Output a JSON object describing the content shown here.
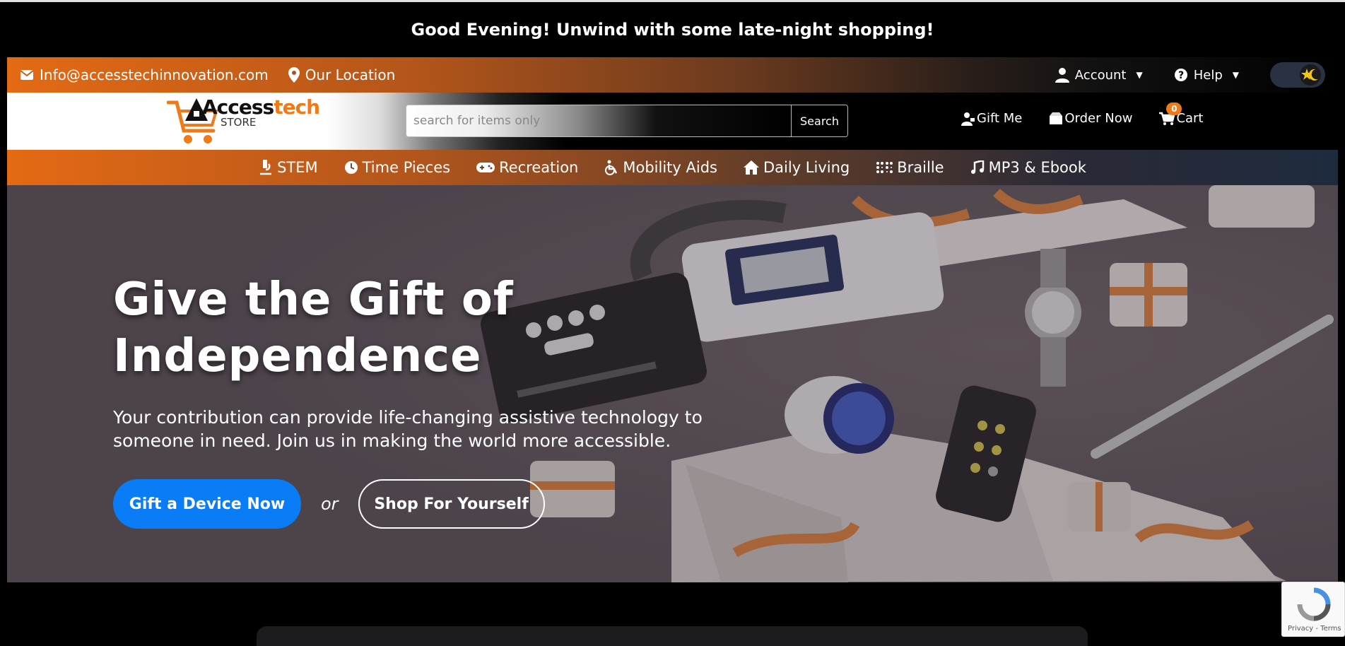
{
  "greeting": "Good Evening! Unwind with some late-night shopping!",
  "topbar": {
    "email": "Info@accesstechinnovation.com",
    "location": "Our Location",
    "account": "Account",
    "help": "Help"
  },
  "header": {
    "logo": {
      "word1": "Access",
      "word2": "tech",
      "sub": "STORE"
    },
    "search": {
      "placeholder": "search for items only",
      "button": "Search"
    },
    "actions": {
      "gift_me": "Gift Me",
      "order_now": "Order Now",
      "cart": "Cart",
      "cart_count": "0"
    }
  },
  "nav": [
    {
      "label": "STEM",
      "icon": "microscope-icon"
    },
    {
      "label": "Time Pieces",
      "icon": "clock-icon"
    },
    {
      "label": "Recreation",
      "icon": "gamepad-icon"
    },
    {
      "label": "Mobility Aids",
      "icon": "wheelchair-icon"
    },
    {
      "label": "Daily Living",
      "icon": "home-icon"
    },
    {
      "label": "Braille",
      "icon": "braille-icon"
    },
    {
      "label": "MP3 & Ebook",
      "icon": "music-icon"
    }
  ],
  "hero": {
    "title": "Give the Gift of Independence",
    "text": "Your contribution can provide life-changing assistive technology to someone in need. Join us in making the world more accessible.",
    "primary_button": "Gift a Device Now",
    "or": "or",
    "secondary_button": "Shop For Yourself"
  },
  "recaptcha": {
    "terms": "Privacy - Terms"
  },
  "colors": {
    "accent": "#e46a14",
    "primary": "#0a7cf5",
    "hero_bg": "#5a5058"
  }
}
